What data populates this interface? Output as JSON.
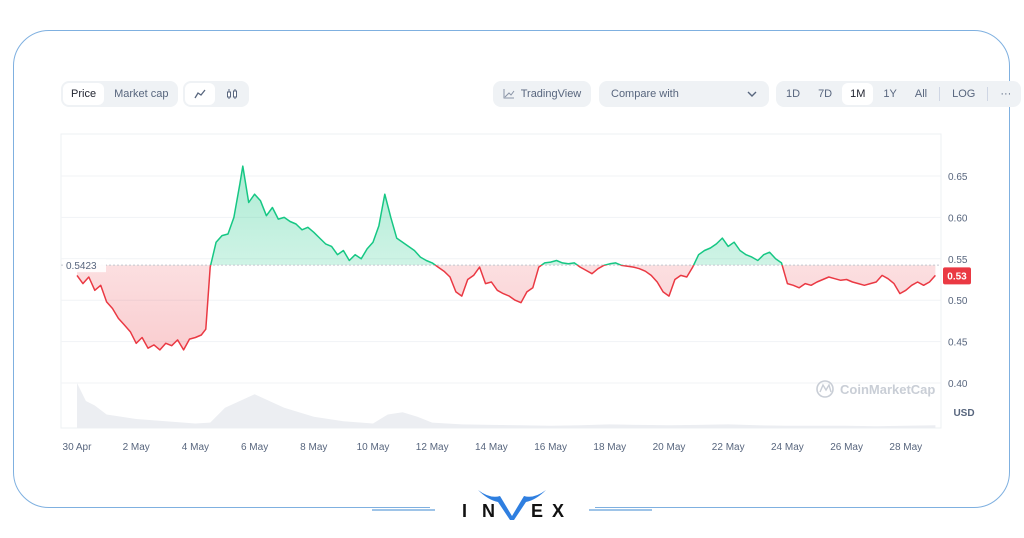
{
  "toolbar": {
    "price_label": "Price",
    "market_cap_label": "Market cap",
    "line_icon": "line-chart-icon",
    "candle_icon": "candlestick-icon",
    "tradingview_label": "TradingView",
    "compare_label": "Compare with",
    "ranges": [
      "1D",
      "7D",
      "1M",
      "1Y",
      "All"
    ],
    "active_range": "1M",
    "log_label": "LOG",
    "more_label": "···"
  },
  "watermark": "CoinMarketCap",
  "brand": {
    "name": "INVEX",
    "letters": [
      "I",
      "N",
      "V",
      "E",
      "X"
    ],
    "accent": "#2f7fe0"
  },
  "colors": {
    "up": "#16c784",
    "down": "#ea3943",
    "current_badge": "#ea3943"
  },
  "chart_data": {
    "type": "area",
    "title": "",
    "xlabel": "",
    "ylabel": "USD",
    "ylim": [
      0.375,
      0.69
    ],
    "yticks": [
      0.4,
      0.45,
      0.5,
      0.55,
      0.6,
      0.65
    ],
    "ytick_labels": [
      "0.40",
      "0.45",
      "0.50",
      "0.55",
      "0.60",
      "0.65"
    ],
    "xtick_labels": [
      "30 Apr",
      "2 May",
      "4 May",
      "6 May",
      "8 May",
      "10 May",
      "12 May",
      "14 May",
      "16 May",
      "18 May",
      "20 May",
      "22 May",
      "24 May",
      "26 May",
      "28 May"
    ],
    "xtick_days": [
      0,
      2,
      4,
      6,
      8,
      10,
      12,
      14,
      16,
      18,
      20,
      22,
      24,
      26,
      28
    ],
    "baseline": 0.5423,
    "baseline_label": "0.5423",
    "current_value_label": "0.53",
    "grid": true,
    "series": [
      {
        "name": "Price",
        "x_days": [
          0,
          0.2,
          0.4,
          0.6,
          0.8,
          1.0,
          1.2,
          1.4,
          1.6,
          1.8,
          2.0,
          2.2,
          2.4,
          2.6,
          2.8,
          3.0,
          3.2,
          3.4,
          3.6,
          3.8,
          4.0,
          4.2,
          4.35,
          4.5,
          4.7,
          4.9,
          5.1,
          5.3,
          5.5,
          5.6,
          5.8,
          6.0,
          6.2,
          6.4,
          6.6,
          6.8,
          7.0,
          7.2,
          7.4,
          7.6,
          7.8,
          8.0,
          8.2,
          8.4,
          8.6,
          8.8,
          9.0,
          9.2,
          9.4,
          9.6,
          9.8,
          10.0,
          10.2,
          10.4,
          10.6,
          10.8,
          11.0,
          11.2,
          11.4,
          11.6,
          11.8,
          12.0,
          12.2,
          12.4,
          12.6,
          12.8,
          13.0,
          13.2,
          13.4,
          13.6,
          13.8,
          14.0,
          14.2,
          14.4,
          14.6,
          14.8,
          15.0,
          15.2,
          15.4,
          15.6,
          15.8,
          16.0,
          16.2,
          16.4,
          16.6,
          16.8,
          17.0,
          17.2,
          17.4,
          17.6,
          17.8,
          18.0,
          18.2,
          18.4,
          18.6,
          18.8,
          19.0,
          19.2,
          19.4,
          19.6,
          19.8,
          20.0,
          20.2,
          20.4,
          20.6,
          20.8,
          21.0,
          21.2,
          21.4,
          21.6,
          21.8,
          22.0,
          22.2,
          22.4,
          22.6,
          22.8,
          23.0,
          23.2,
          23.4,
          23.6,
          23.8,
          24.0,
          24.2,
          24.4,
          24.6,
          24.8,
          25.0,
          25.2,
          25.4,
          25.6,
          25.8,
          26.0,
          26.2,
          26.4,
          26.6,
          26.8,
          27.0,
          27.2,
          27.4,
          27.6,
          27.8,
          28.0,
          28.2,
          28.4,
          28.6,
          28.8,
          29.0
        ],
        "values": [
          0.53,
          0.52,
          0.528,
          0.512,
          0.518,
          0.498,
          0.49,
          0.478,
          0.47,
          0.462,
          0.448,
          0.455,
          0.442,
          0.446,
          0.44,
          0.448,
          0.445,
          0.452,
          0.44,
          0.453,
          0.455,
          0.458,
          0.465,
          0.54,
          0.57,
          0.578,
          0.58,
          0.6,
          0.64,
          0.662,
          0.618,
          0.628,
          0.62,
          0.602,
          0.612,
          0.598,
          0.6,
          0.595,
          0.592,
          0.585,
          0.588,
          0.582,
          0.575,
          0.568,
          0.565,
          0.555,
          0.56,
          0.548,
          0.555,
          0.55,
          0.562,
          0.57,
          0.59,
          0.628,
          0.6,
          0.575,
          0.57,
          0.565,
          0.56,
          0.552,
          0.548,
          0.545,
          0.54,
          0.535,
          0.528,
          0.51,
          0.505,
          0.525,
          0.53,
          0.54,
          0.52,
          0.522,
          0.512,
          0.508,
          0.505,
          0.5,
          0.497,
          0.51,
          0.515,
          0.54,
          0.545,
          0.546,
          0.548,
          0.545,
          0.544,
          0.545,
          0.54,
          0.536,
          0.532,
          0.538,
          0.542,
          0.544,
          0.545,
          0.542,
          0.541,
          0.54,
          0.538,
          0.535,
          0.53,
          0.522,
          0.51,
          0.505,
          0.525,
          0.53,
          0.528,
          0.54,
          0.555,
          0.56,
          0.563,
          0.568,
          0.575,
          0.565,
          0.57,
          0.56,
          0.555,
          0.552,
          0.548,
          0.555,
          0.558,
          0.55,
          0.545,
          0.52,
          0.518,
          0.515,
          0.52,
          0.518,
          0.522,
          0.525,
          0.528,
          0.526,
          0.524,
          0.525,
          0.522,
          0.52,
          0.518,
          0.52,
          0.522,
          0.53,
          0.526,
          0.52,
          0.508,
          0.512,
          0.518,
          0.522,
          0.518,
          0.522,
          0.53,
          0.532,
          0.53
        ]
      }
    ],
    "volume": {
      "x_days": [
        0,
        0.3,
        0.6,
        1,
        2,
        3,
        4,
        4.5,
        5,
        5.5,
        6,
        6.5,
        7,
        8,
        9,
        10,
        10.5,
        11,
        11.5,
        12,
        13,
        14,
        15,
        16,
        17,
        18,
        19,
        20,
        21,
        22,
        23,
        24,
        25,
        26,
        27,
        28,
        29
      ],
      "values": [
        1.0,
        0.6,
        0.5,
        0.3,
        0.2,
        0.15,
        0.1,
        0.12,
        0.45,
        0.6,
        0.75,
        0.6,
        0.45,
        0.25,
        0.15,
        0.1,
        0.3,
        0.35,
        0.25,
        0.12,
        0.08,
        0.07,
        0.06,
        0.05,
        0.06,
        0.08,
        0.07,
        0.06,
        0.07,
        0.08,
        0.06,
        0.05,
        0.05,
        0.05,
        0.04,
        0.05,
        0.06
      ]
    }
  }
}
